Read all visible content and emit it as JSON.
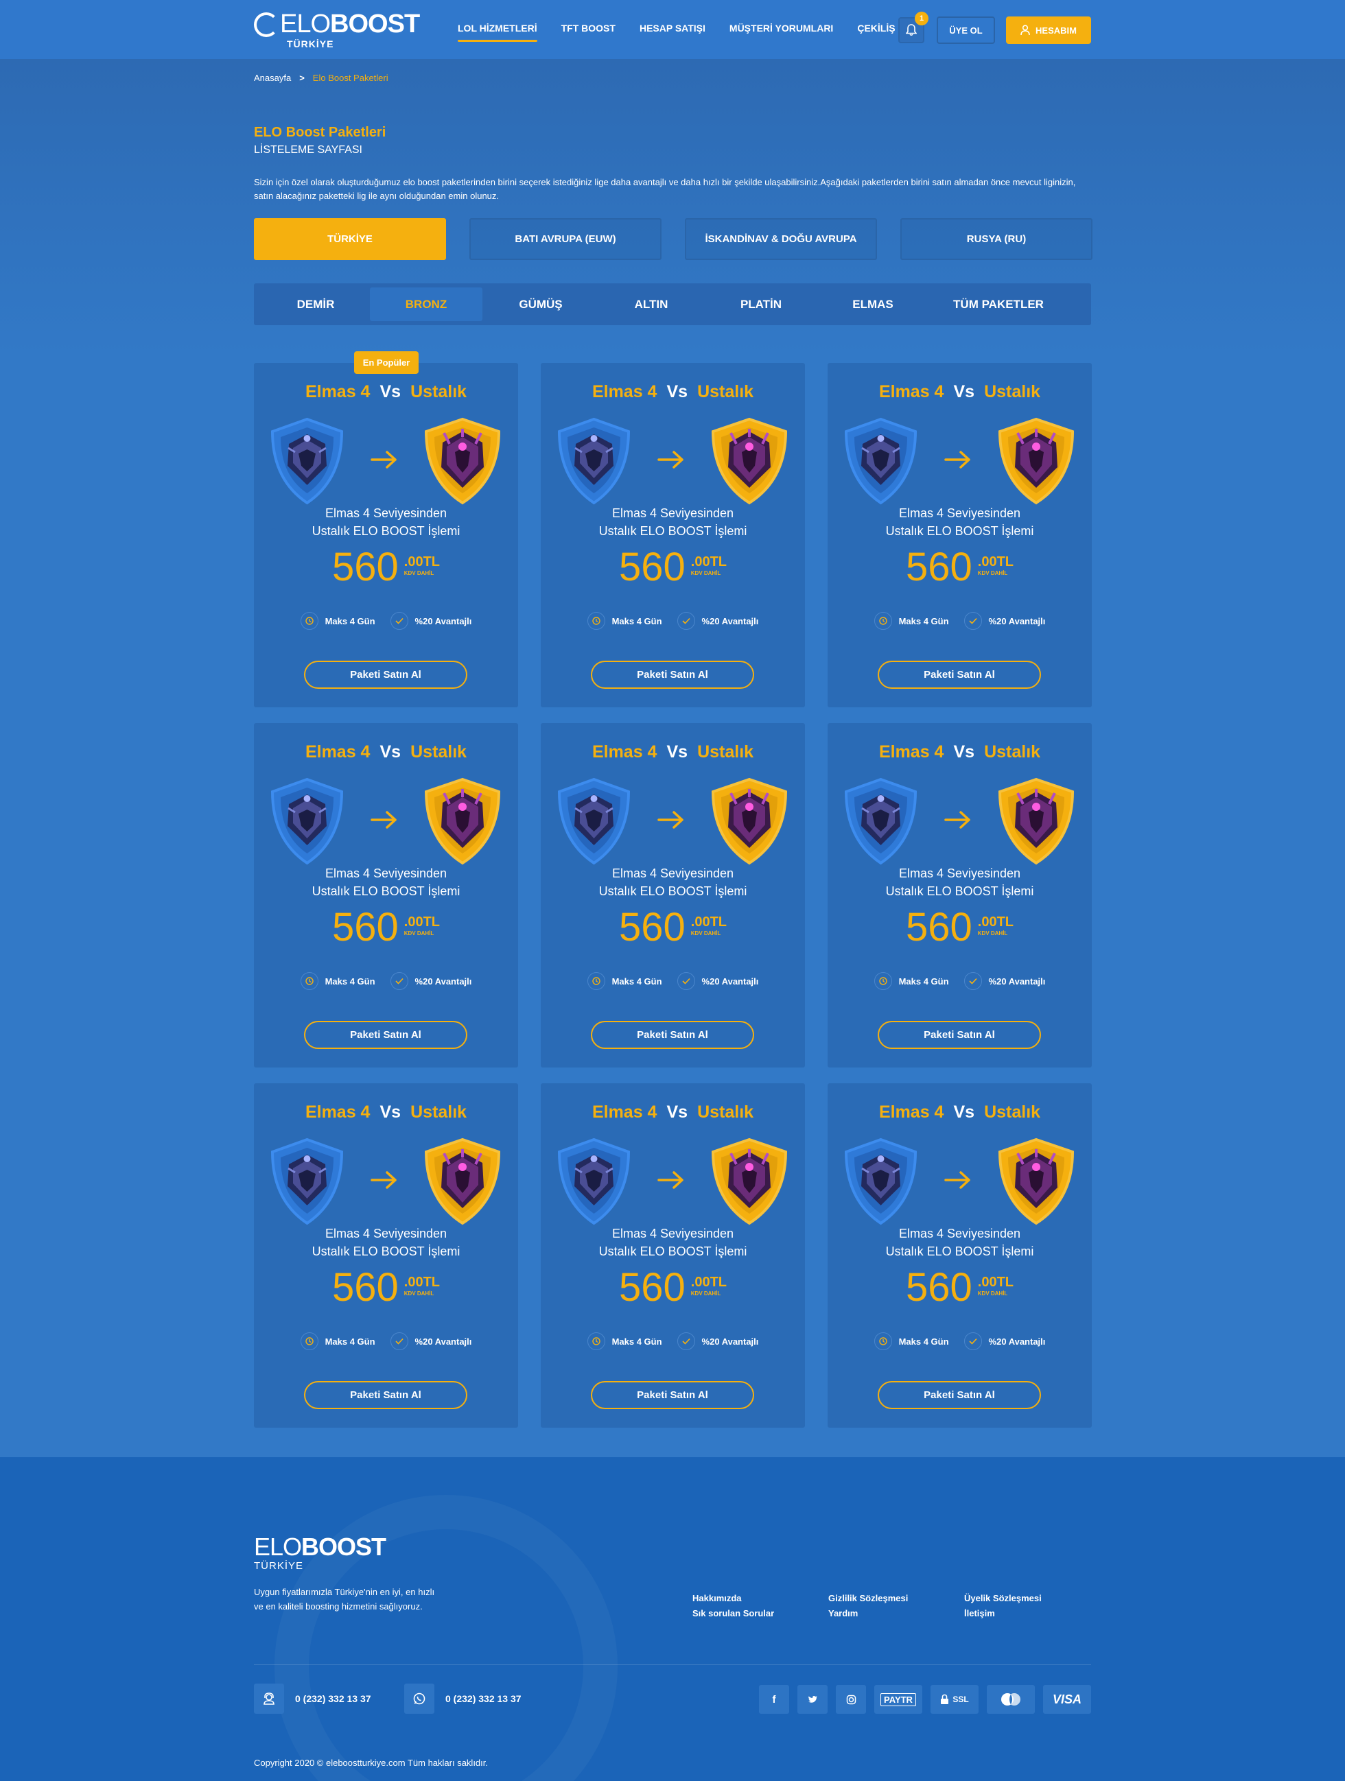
{
  "header": {
    "logo_main_light": "ELO",
    "logo_main_bold": "BOOST",
    "logo_sub": "TÜRKİYE",
    "nav": [
      "LOL HİZMETLERİ",
      "TFT BOOST",
      "HESAP SATIŞI",
      "MÜŞTERİ YORUMLARI",
      "ÇEKİLİŞ"
    ],
    "notification_count": "1",
    "register_label": "ÜYE OL",
    "account_label": "HESABIM"
  },
  "breadcrumb": {
    "home": "Anasayfa",
    "separator": ">",
    "current": "Elo Boost Paketleri"
  },
  "page": {
    "title": "ELO Boost Paketleri",
    "subtitle": "LİSTELEME SAYFASI",
    "description": "Sizin için özel olarak oluşturduğumuz elo boost paketlerinden birini seçerek istediğiniz lige daha avantajlı ve daha hızlı bir şekilde ulaşabilirsiniz.Aşağıdaki paketlerden birini satın almadan önce mevcut liginizin, satın alacağınız paketteki lig ile aynı olduğundan emin olunuz."
  },
  "regions": [
    "TÜRKİYE",
    "BATI AVRUPA (EUW)",
    "İSKANDİNAV & DOĞU AVRUPA",
    "RUSYA (RU)"
  ],
  "tiers": [
    "DEMİR",
    "BRONZ",
    "GÜMÜŞ",
    "ALTIN",
    "PLATİN",
    "ELMAS",
    "TÜM PAKETLER"
  ],
  "card": {
    "popular_badge": "En Popüler",
    "from": "Elmas 4",
    "vs": "Vs",
    "to": "Ustalık",
    "desc_line1": "Elmas 4 Seviyesinden",
    "desc_line2": "Ustalık ELO BOOST İşlemi",
    "price": "560",
    "price_cents": ".00TL",
    "price_tax": "KDV DAHİL",
    "feature_time": "Maks 4 Gün",
    "feature_adv": "%20 Avantajlı",
    "buy_label": "Paketi Satın Al"
  },
  "footer": {
    "logo_light": "ELO",
    "logo_bold": "BOOST",
    "logo_sub": "TÜRKİYE",
    "tagline": "Uygun fiyatlarımızla Türkiye'nin en iyi, en hızlı ve en kaliteli boosting hizmetini sağlıyoruz.",
    "links": [
      "Hakkımızda",
      "Gizlilik Sözleşmesi",
      "Üyelik Sözleşmesi",
      "Sık sorulan Sorular",
      "Yardım",
      "İletişim"
    ],
    "phone1": "0 (232) 332 13 37",
    "phone2": "0 (232) 332 13 37",
    "socials": [
      "f",
      "t",
      "◎"
    ],
    "payments": [
      "PAYTR",
      "SSL",
      "VISA"
    ],
    "copyright": "Copyright 2020 © eleboostturkiye.com Tüm hakları saklıdır."
  },
  "colors": {
    "accent": "#f5b00f",
    "background": "#3279c7",
    "card": "#2a6bb6",
    "footer": "#1b64b8"
  }
}
